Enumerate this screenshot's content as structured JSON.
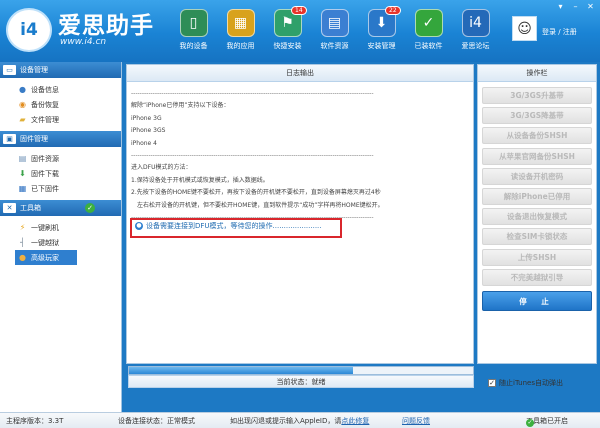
{
  "header": {
    "brand_title": "爱思助手",
    "brand_url": "www.i4.cn",
    "logo_text": "i4",
    "login_text": "登录 / 注册",
    "nav": [
      {
        "label": "我的设备",
        "icon": "device-icon",
        "badge": ""
      },
      {
        "label": "我的应用",
        "icon": "apps-icon",
        "badge": ""
      },
      {
        "label": "快捷安装",
        "icon": "quick-install-icon",
        "badge": "14"
      },
      {
        "label": "软件资源",
        "icon": "software-icon",
        "badge": ""
      },
      {
        "label": "安装管理",
        "icon": "install-manage-icon",
        "badge": "22"
      },
      {
        "label": "已装软件",
        "icon": "installed-icon",
        "badge": ""
      },
      {
        "label": "爱思论坛",
        "icon": "forum-icon",
        "badge": ""
      }
    ]
  },
  "sidebar": {
    "sections": [
      {
        "title": "设备管理",
        "items": [
          {
            "label": "设备信息"
          },
          {
            "label": "备份恢复"
          },
          {
            "label": "文件管理"
          }
        ]
      },
      {
        "title": "固件管理",
        "items": [
          {
            "label": "固件资源"
          },
          {
            "label": "固件下载"
          },
          {
            "label": "已下固件"
          }
        ]
      },
      {
        "title": "工具箱",
        "items": [
          {
            "label": "一键刷机"
          },
          {
            "label": "一键越狱"
          },
          {
            "label": "高级玩家"
          }
        ]
      }
    ]
  },
  "log": {
    "title": "日志输出",
    "lines": [
      "解除“iPhone已停用”支持以下设备：",
      "iPhone 3G",
      "iPhone 3GS",
      "iPhone 4",
      "进入DFU模式的方法：",
      "1.保持设备处于开机模式或恢复模式，插入数据线。",
      "2.先按下设备的HOME键不要松开，再按下设备的开机键不要松开，直到设备屏幕熄灭再过4秒",
      "左右松开设备的开机键，但不要松开HOME键，直到软件提示“成功”字样再将HOME键松开。"
    ],
    "separator": "----------------------------------------------------------------------------------------------------------------",
    "highlight": "设备需要连接到DFU模式，等待您的操作......................"
  },
  "status": {
    "progress": 0.65,
    "text": "当前状态：就绪"
  },
  "operations": {
    "title": "操作栏",
    "buttons": [
      "3G/3GS升基带",
      "3G/3GS降基带",
      "从设备备份SHSH",
      "从苹果官网备份SHSH",
      "读设备开机密码",
      "解除iPhone已停用",
      "设备退出恢复模式",
      "检查SIM卡锁状态",
      "上传SHSH",
      "不完美越狱引导"
    ],
    "stop_label": "停 止",
    "auto_exit_label": "随止iTunes自动弹出"
  },
  "footer": {
    "version": "主程序版本：3.3T",
    "connection": "设备连接状态：正常模式",
    "hint_prefix": "如出现闪退或提示输入AppleID，请",
    "hint_link": "点此修复",
    "feedback": "问题反馈",
    "itunes": "工具箱已开启"
  },
  "colors": {
    "accent": "#1a83d4",
    "highlight_border": "#d9262c",
    "stop_button": "#1f74c7"
  }
}
